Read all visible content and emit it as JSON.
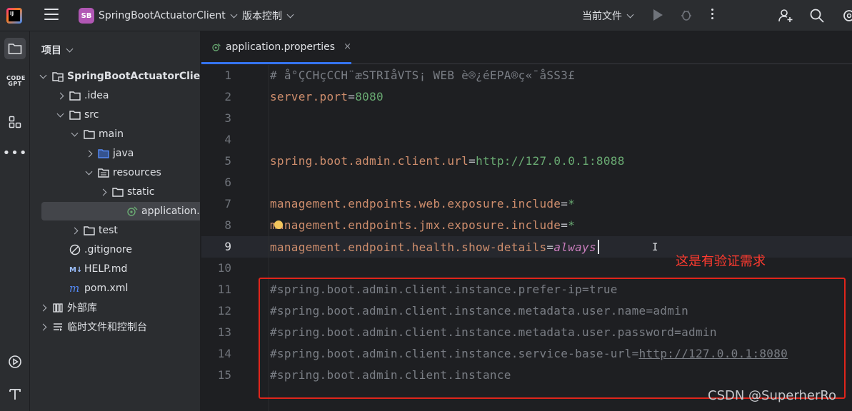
{
  "titlebar": {
    "project_badge": "SB",
    "project_name": "SpringBootActuatorClient",
    "vcs_label": "版本控制",
    "run_config": "当前文件"
  },
  "sidebar_tools": [
    "project-folder-icon",
    "codegpt-icon",
    "structure-icon",
    "more-icon",
    "run-services-icon",
    "terminal-icon"
  ],
  "codegpt_label": "CODE GPT",
  "project_panel": {
    "title": "项目",
    "tree": [
      {
        "label": "SpringBootActuatorClient",
        "bold": true,
        "arrow": "down",
        "icon": "module-folder-icon"
      },
      {
        "label": ".idea",
        "arrow": "right",
        "icon": "folder-icon"
      },
      {
        "label": "src",
        "arrow": "down",
        "icon": "folder-icon"
      },
      {
        "label": "main",
        "arrow": "down",
        "icon": "folder-icon"
      },
      {
        "label": "java",
        "arrow": "right",
        "icon": "source-folder-icon"
      },
      {
        "label": "resources",
        "arrow": "down",
        "icon": "resources-folder-icon"
      },
      {
        "label": "static",
        "arrow": "right",
        "icon": "folder-icon"
      },
      {
        "label": "application.properties",
        "arrow": "none",
        "icon": "properties-file-icon",
        "selected": true
      },
      {
        "label": "test",
        "arrow": "right",
        "icon": "folder-icon"
      },
      {
        "label": ".gitignore",
        "arrow": "none",
        "icon": "gitignore-icon"
      },
      {
        "label": "HELP.md",
        "arrow": "none",
        "icon": "markdown-icon"
      },
      {
        "label": "pom.xml",
        "arrow": "none",
        "icon": "maven-icon"
      },
      {
        "label": "外部库",
        "arrow": "right",
        "icon": "library-icon"
      },
      {
        "label": "临时文件和控制台",
        "arrow": "right",
        "icon": "scratch-icon"
      }
    ]
  },
  "editor": {
    "tab_label": "application.properties",
    "tab_close": "×",
    "current_line": 9,
    "lines": [
      {
        "n": "1",
        "kind": "comment",
        "text": "# å°ÇCHçCCH¨æSTRIåVTS¡ WEB è®¿éEPA®ç«¯åSS3£"
      },
      {
        "n": "2",
        "kind": "prop",
        "key": "server.port",
        "value": "8080"
      },
      {
        "n": "3",
        "kind": "blank"
      },
      {
        "n": "4",
        "kind": "blank"
      },
      {
        "n": "5",
        "kind": "prop",
        "key": "spring.boot.admin.client.url",
        "value": "http://127.0.0.1:8088"
      },
      {
        "n": "6",
        "kind": "blank"
      },
      {
        "n": "7",
        "kind": "prop",
        "key": "management.endpoints.web.exposure.include",
        "value": "*"
      },
      {
        "n": "8",
        "kind": "prop",
        "key": "management.endpoints.jmx.exposure.include",
        "value": "*"
      },
      {
        "n": "9",
        "kind": "prop",
        "key": "management.endpoint.health.show-details",
        "value": "always",
        "italic": true
      },
      {
        "n": "10",
        "kind": "blank"
      },
      {
        "n": "11",
        "kind": "comment",
        "text": "#spring.boot.admin.client.instance.prefer-ip=true"
      },
      {
        "n": "12",
        "kind": "comment",
        "text": "#spring.boot.admin.client.instance.metadata.user.name=admin"
      },
      {
        "n": "13",
        "kind": "comment",
        "text": "#spring.boot.admin.client.instance.metadata.user.password=admin"
      },
      {
        "n": "14",
        "kind": "comment-url",
        "text": "#spring.boot.admin.client.instance.service-base-url=",
        "url": "http://127.0.0.1:8080"
      },
      {
        "n": "15",
        "kind": "comment",
        "text": "#spring.boot.admin.client.instance"
      }
    ]
  },
  "annotation": "这是有验证需求",
  "watermark": "CSDN @SuperherRo",
  "colors": {
    "accent": "#3574f0",
    "annotation": "#ff3b30",
    "box": "#e0251b"
  }
}
